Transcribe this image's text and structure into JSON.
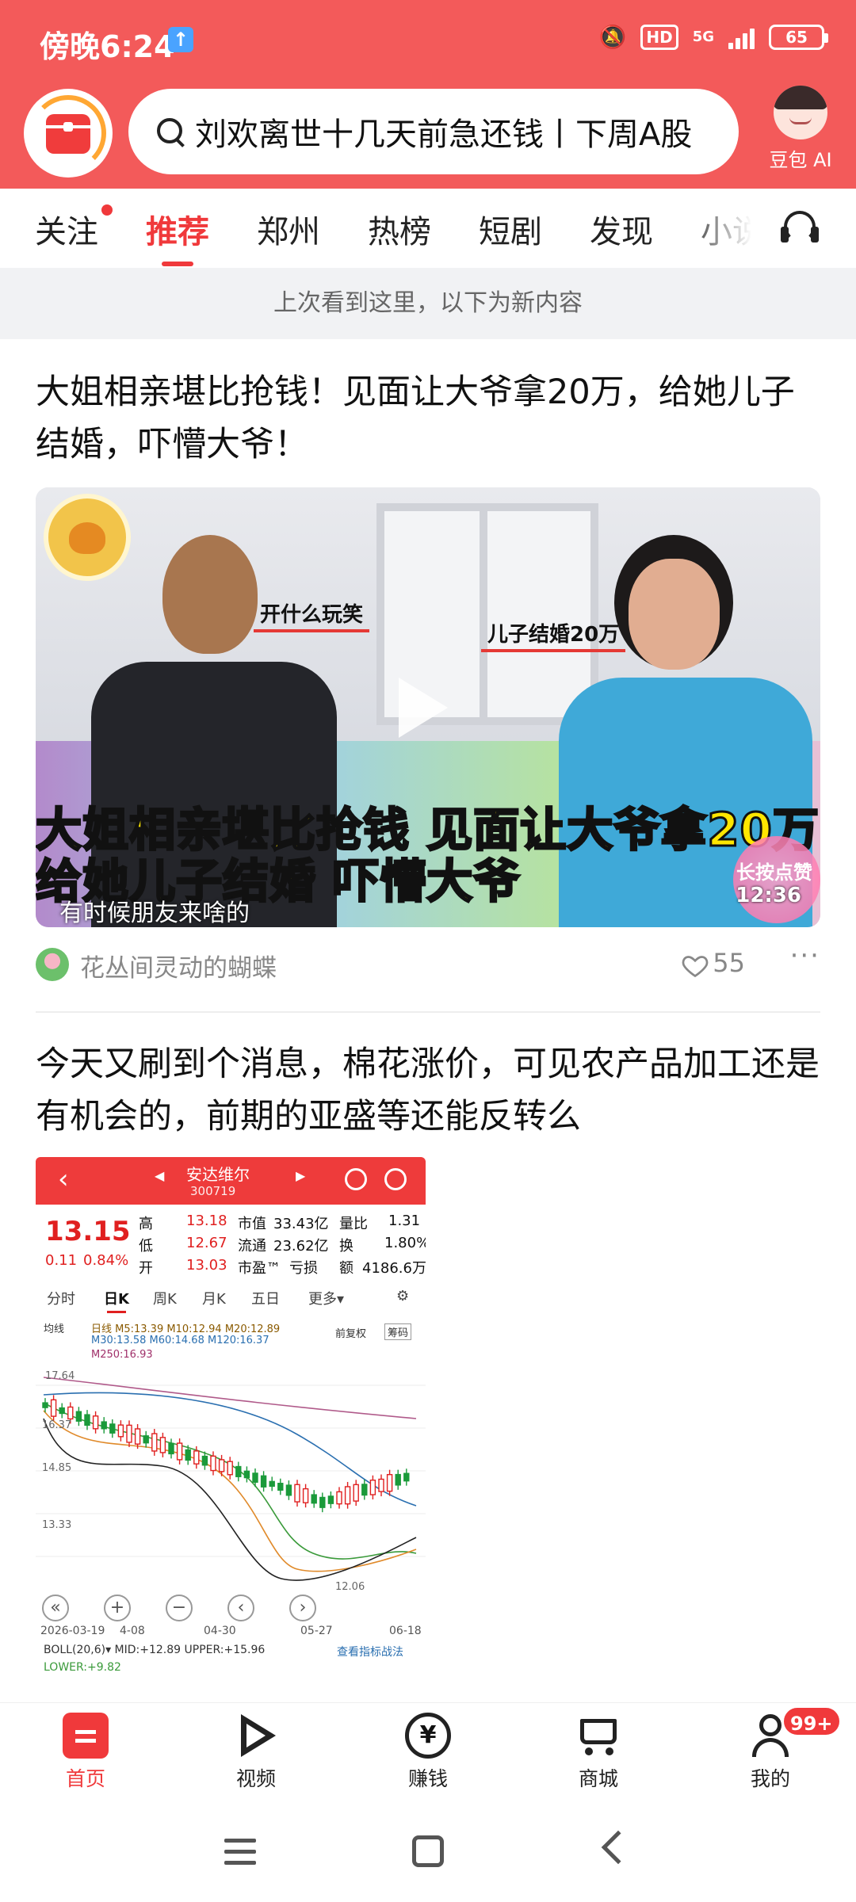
{
  "status_bar": {
    "time": "傍晚6:24",
    "network": "5G",
    "hd": "HD",
    "battery": "65"
  },
  "search": {
    "text": "刘欢离世十几天前急还钱丨下周A股"
  },
  "assistant": {
    "label": "豆包 AI"
  },
  "channels": [
    {
      "label": "关注",
      "has_dot": true
    },
    {
      "label": "推荐",
      "active": true
    },
    {
      "label": "郑州"
    },
    {
      "label": "热榜"
    },
    {
      "label": "短剧"
    },
    {
      "label": "发现"
    },
    {
      "label": "小说"
    }
  ],
  "notice": "上次看到这里，以下为新内容",
  "post1": {
    "title": "大姐相亲堪比抢钱！见面让大爷拿20万，给她儿子结婚，吓懵大爷！",
    "video": {
      "tag_left": "开什么玩笑",
      "tag_right": "儿子结婚20万",
      "caption_line1": "大姐相亲堪比抢钱 见面让大爷拿20万",
      "caption_line2": "给她儿子结婚 吓懵大爷",
      "subtitle": "有时候朋友来啥的",
      "like_tip": "长按点赞",
      "duration": "12:36"
    },
    "author": "花丛间灵动的蝴蝶",
    "likes": "55",
    "more": "···"
  },
  "post2": {
    "title": "今天又刷到个消息，棉花涨价，可见农产品加工还是有机会的，前期的亚盛等还能反转么",
    "stock": {
      "name": "安达维尔",
      "code": "300719",
      "price": "13.15",
      "change": "0.11",
      "change_pct": "0.84%",
      "quote_rows": [
        {
          "k1": "高",
          "v1": "13.18",
          "k2": "市值",
          "v2": "33.43亿",
          "k3": "量比",
          "v3": "1.31"
        },
        {
          "k1": "低",
          "v1": "12.67",
          "k2": "流通",
          "v2": "23.62亿",
          "k3": "换",
          "v3": "1.80%"
        },
        {
          "k1": "开",
          "v1": "13.03",
          "k2": "市盈™",
          "v2": "亏损",
          "k3": "额",
          "v3": "4186.6万"
        }
      ],
      "tabs": [
        "分时",
        "日K",
        "周K",
        "月K",
        "五日",
        "更多▾"
      ],
      "ma_line1": "日线  M5:13.39  M10:12.94  M20:12.89",
      "ma_line2": "M30:13.58  M60:14.68  M120:16.37",
      "ma_line3": "M250:16.93",
      "ma_toggle": "均线",
      "fq": "前复权",
      "chips": "筹码",
      "y_ticks": [
        "17.64",
        "16.37",
        "14.85",
        "13.33",
        "12.06"
      ],
      "dates": [
        "2026-03-19",
        "4-08",
        "04-30",
        "05-27",
        "06-18"
      ],
      "boll": "BOLL(20,6)▾  MID:+12.89  UPPER:+15.96",
      "boll_link": "查看指标战法",
      "boll_lower": "LOWER:+9.82"
    }
  },
  "bottom_nav": [
    {
      "label": "首页",
      "active": true
    },
    {
      "label": "视频"
    },
    {
      "label": "赚钱"
    },
    {
      "label": "商城"
    },
    {
      "label": "我的"
    }
  ],
  "badge_me": "99+",
  "icons": {
    "earn": "¥",
    "chart_back": "‹"
  },
  "colors": {
    "brand_red": "#f35a5a",
    "accent_red": "#f0393b",
    "caption_yellow": "#ffe600"
  }
}
